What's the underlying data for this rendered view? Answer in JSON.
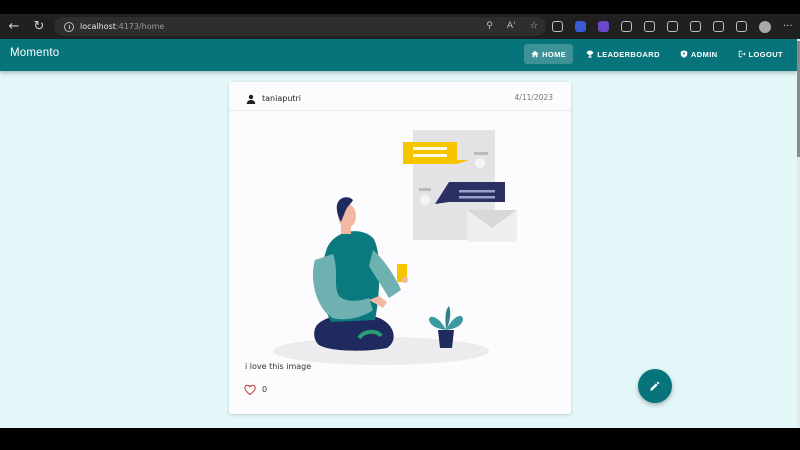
{
  "browser": {
    "url_host": "localhost",
    "url_path": ":4173/home"
  },
  "app": {
    "brand": "Momento",
    "nav": [
      {
        "label": "HOME",
        "icon": "home-icon",
        "active": true
      },
      {
        "label": "LEADERBOARD",
        "icon": "trophy-icon",
        "active": false
      },
      {
        "label": "ADMIN",
        "icon": "shield-icon",
        "active": false
      },
      {
        "label": "LOGOUT",
        "icon": "logout-icon",
        "active": false
      }
    ]
  },
  "post": {
    "username": "taniaputri",
    "date": "4/11/2023",
    "caption": "i love this image",
    "likes": "0"
  },
  "colors": {
    "primary": "#06747a",
    "background": "#e3f7f9",
    "card": "#fcfcfe"
  }
}
